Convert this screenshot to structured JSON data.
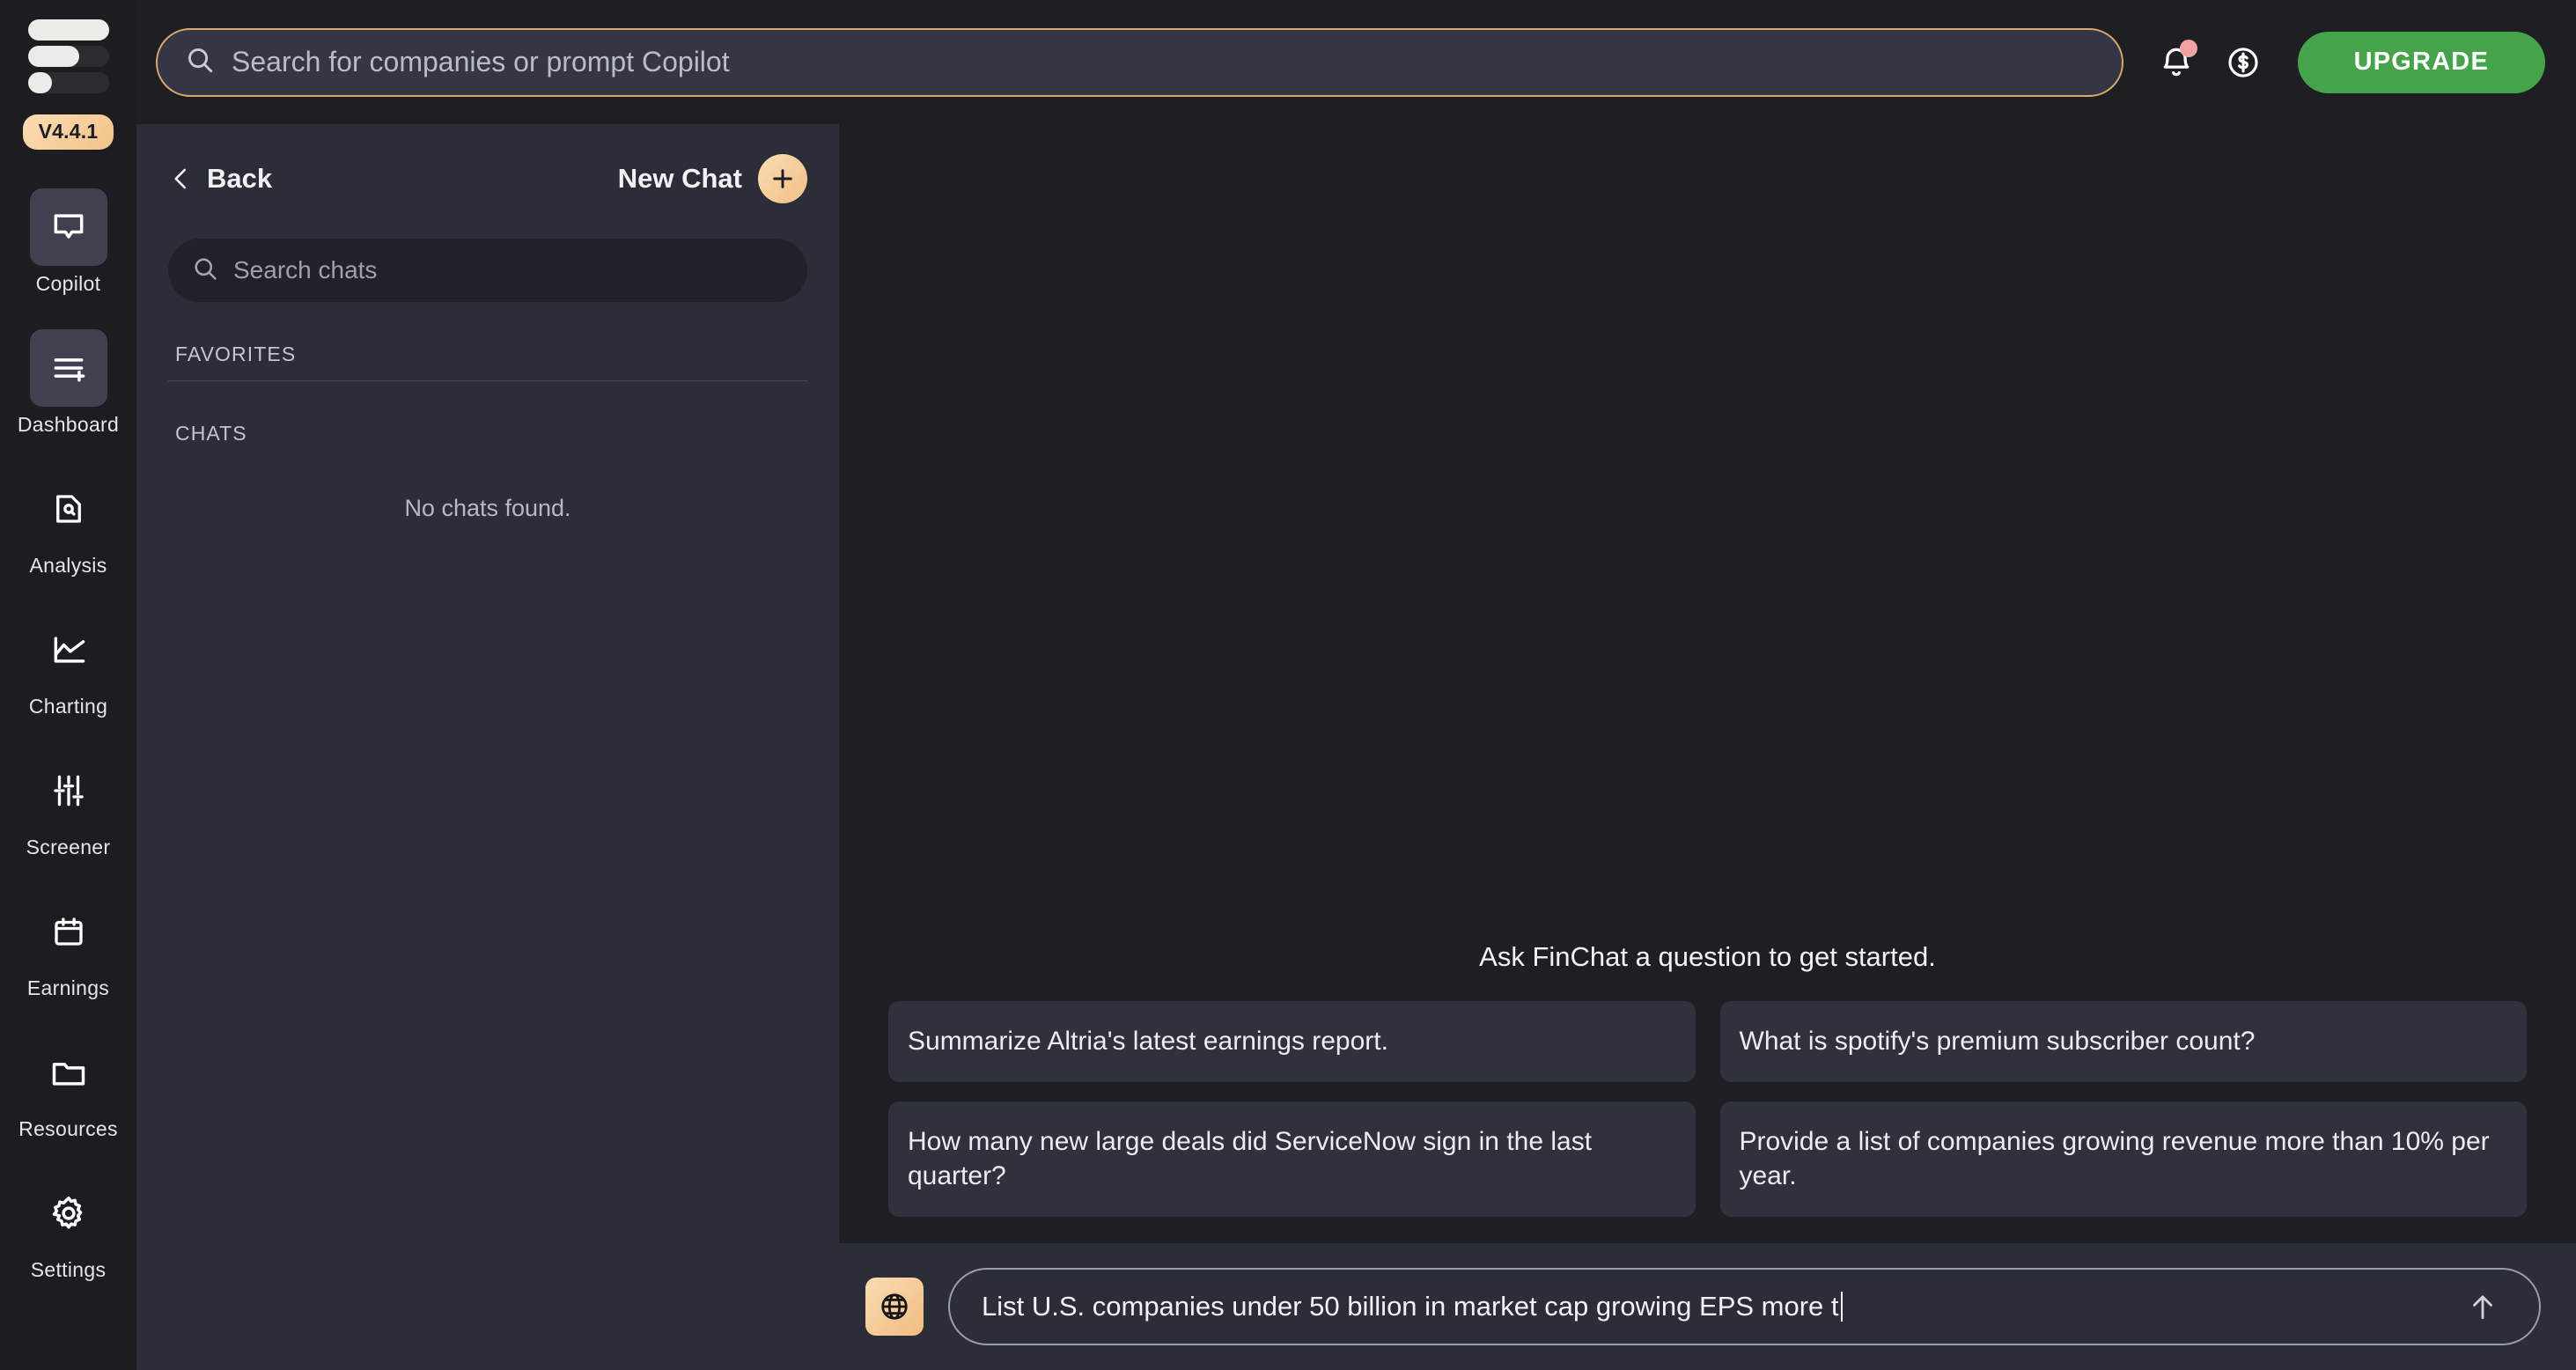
{
  "rail": {
    "logo_name": "finchat-logo",
    "version_badge": "V4.4.1",
    "items": [
      {
        "label": "Copilot",
        "icon": "speech-bubble-icon",
        "active": true
      },
      {
        "label": "Dashboard",
        "icon": "dashboard-add-icon",
        "active": true
      },
      {
        "label": "Analysis",
        "icon": "document-search-icon",
        "active": false
      },
      {
        "label": "Charting",
        "icon": "line-chart-icon",
        "active": false
      },
      {
        "label": "Screener",
        "icon": "sliders-icon",
        "active": false
      },
      {
        "label": "Earnings",
        "icon": "calendar-icon",
        "active": false
      },
      {
        "label": "Resources",
        "icon": "folder-icon",
        "active": false
      },
      {
        "label": "Settings",
        "icon": "gear-icon",
        "active": false
      }
    ]
  },
  "topbar": {
    "search_placeholder": "Search for companies or prompt Copilot",
    "search_icon": "search-icon",
    "notifications_icon": "bell-icon",
    "has_notification": true,
    "billing_icon": "dollar-circle-icon",
    "upgrade_label": "UPGRADE",
    "upgrade_color": "#45a449",
    "accent_color": "#d5a96a"
  },
  "chat_panel": {
    "back_label": "Back",
    "back_icon": "chevron-left-icon",
    "new_chat_label": "New Chat",
    "new_chat_icon": "plus-icon",
    "search_placeholder": "Search chats",
    "search_icon": "search-icon",
    "favorites_heading": "FAVORITES",
    "chats_heading": "CHATS",
    "empty_state": "No chats found."
  },
  "main": {
    "starter_title": "Ask FinChat a question to get started.",
    "suggestions": [
      "Summarize Altria's latest earnings report.",
      "What is spotify's premium subscriber count?",
      "How many new large deals did ServiceNow sign in the last quarter?",
      "Provide a list of companies growing revenue more than 10% per year."
    ]
  },
  "composer": {
    "web_toggle_icon": "globe-icon",
    "input_value": "List U.S. companies under 50 billion in market cap growing EPS more t",
    "send_icon": "arrow-up-icon"
  }
}
